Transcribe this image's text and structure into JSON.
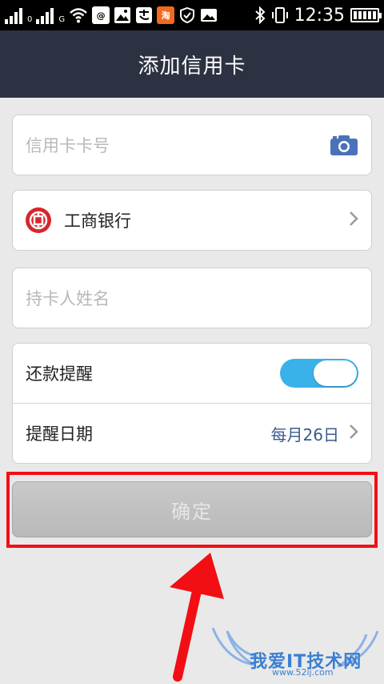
{
  "status_bar": {
    "sim1_label": "0",
    "sim2_label": "G",
    "notif_baidu": "@",
    "notif_taobao": "淘",
    "time": "12:35"
  },
  "header": {
    "title": "添加信用卡"
  },
  "form": {
    "card_number": {
      "placeholder": "信用卡卡号",
      "value": ""
    },
    "bank": {
      "name": "工商银行"
    },
    "holder_name": {
      "placeholder": "持卡人姓名",
      "value": ""
    },
    "reminder": {
      "label": "还款提醒",
      "enabled": true
    },
    "reminder_date": {
      "label": "提醒日期",
      "value": "每月26日"
    }
  },
  "confirm_label": "确定",
  "watermark": {
    "text": "我爱IT技术网",
    "sub": "www.52ij.com"
  },
  "colors": {
    "titlebar_bg": "#2c3242",
    "toggle_on": "#3ab1e8",
    "highlight_red": "#f20f14",
    "bank_red": "#d6262c",
    "date_blue": "#3a5b8c"
  }
}
